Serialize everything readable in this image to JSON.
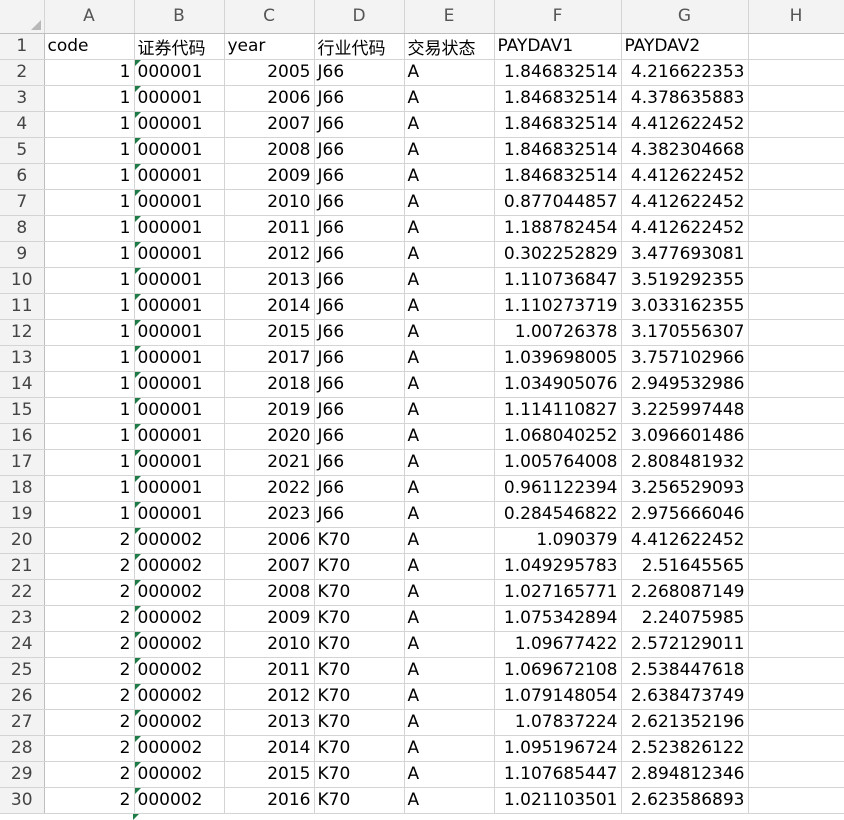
{
  "spreadsheet": {
    "columns": [
      "A",
      "B",
      "C",
      "D",
      "E",
      "F",
      "G",
      "H"
    ],
    "header_row": {
      "num": "1",
      "cells": [
        "code",
        "证券代码",
        "year",
        "行业代码",
        "交易状态",
        "PAYDAV1",
        "PAYDAV2",
        ""
      ]
    },
    "rows": [
      {
        "num": "2",
        "code": "1",
        "sec": "000001",
        "year": "2005",
        "ind": "J66",
        "status": "A",
        "p1": "1.846832514",
        "p2": "4.216622353"
      },
      {
        "num": "3",
        "code": "1",
        "sec": "000001",
        "year": "2006",
        "ind": "J66",
        "status": "A",
        "p1": "1.846832514",
        "p2": "4.378635883"
      },
      {
        "num": "4",
        "code": "1",
        "sec": "000001",
        "year": "2007",
        "ind": "J66",
        "status": "A",
        "p1": "1.846832514",
        "p2": "4.412622452"
      },
      {
        "num": "5",
        "code": "1",
        "sec": "000001",
        "year": "2008",
        "ind": "J66",
        "status": "A",
        "p1": "1.846832514",
        "p2": "4.382304668"
      },
      {
        "num": "6",
        "code": "1",
        "sec": "000001",
        "year": "2009",
        "ind": "J66",
        "status": "A",
        "p1": "1.846832514",
        "p2": "4.412622452"
      },
      {
        "num": "7",
        "code": "1",
        "sec": "000001",
        "year": "2010",
        "ind": "J66",
        "status": "A",
        "p1": "0.877044857",
        "p2": "4.412622452"
      },
      {
        "num": "8",
        "code": "1",
        "sec": "000001",
        "year": "2011",
        "ind": "J66",
        "status": "A",
        "p1": "1.188782454",
        "p2": "4.412622452"
      },
      {
        "num": "9",
        "code": "1",
        "sec": "000001",
        "year": "2012",
        "ind": "J66",
        "status": "A",
        "p1": "0.302252829",
        "p2": "3.477693081"
      },
      {
        "num": "10",
        "code": "1",
        "sec": "000001",
        "year": "2013",
        "ind": "J66",
        "status": "A",
        "p1": "1.110736847",
        "p2": "3.519292355"
      },
      {
        "num": "11",
        "code": "1",
        "sec": "000001",
        "year": "2014",
        "ind": "J66",
        "status": "A",
        "p1": "1.110273719",
        "p2": "3.033162355"
      },
      {
        "num": "12",
        "code": "1",
        "sec": "000001",
        "year": "2015",
        "ind": "J66",
        "status": "A",
        "p1": "1.00726378",
        "p2": "3.170556307"
      },
      {
        "num": "13",
        "code": "1",
        "sec": "000001",
        "year": "2017",
        "ind": "J66",
        "status": "A",
        "p1": "1.039698005",
        "p2": "3.757102966"
      },
      {
        "num": "14",
        "code": "1",
        "sec": "000001",
        "year": "2018",
        "ind": "J66",
        "status": "A",
        "p1": "1.034905076",
        "p2": "2.949532986"
      },
      {
        "num": "15",
        "code": "1",
        "sec": "000001",
        "year": "2019",
        "ind": "J66",
        "status": "A",
        "p1": "1.114110827",
        "p2": "3.225997448"
      },
      {
        "num": "16",
        "code": "1",
        "sec": "000001",
        "year": "2020",
        "ind": "J66",
        "status": "A",
        "p1": "1.068040252",
        "p2": "3.096601486"
      },
      {
        "num": "17",
        "code": "1",
        "sec": "000001",
        "year": "2021",
        "ind": "J66",
        "status": "A",
        "p1": "1.005764008",
        "p2": "2.808481932"
      },
      {
        "num": "18",
        "code": "1",
        "sec": "000001",
        "year": "2022",
        "ind": "J66",
        "status": "A",
        "p1": "0.961122394",
        "p2": "3.256529093"
      },
      {
        "num": "19",
        "code": "1",
        "sec": "000001",
        "year": "2023",
        "ind": "J66",
        "status": "A",
        "p1": "0.284546822",
        "p2": "2.975666046"
      },
      {
        "num": "20",
        "code": "2",
        "sec": "000002",
        "year": "2006",
        "ind": "K70",
        "status": "A",
        "p1": "1.090379",
        "p2": "4.412622452"
      },
      {
        "num": "21",
        "code": "2",
        "sec": "000002",
        "year": "2007",
        "ind": "K70",
        "status": "A",
        "p1": "1.049295783",
        "p2": "2.51645565"
      },
      {
        "num": "22",
        "code": "2",
        "sec": "000002",
        "year": "2008",
        "ind": "K70",
        "status": "A",
        "p1": "1.027165771",
        "p2": "2.268087149"
      },
      {
        "num": "23",
        "code": "2",
        "sec": "000002",
        "year": "2009",
        "ind": "K70",
        "status": "A",
        "p1": "1.075342894",
        "p2": "2.24075985"
      },
      {
        "num": "24",
        "code": "2",
        "sec": "000002",
        "year": "2010",
        "ind": "K70",
        "status": "A",
        "p1": "1.09677422",
        "p2": "2.572129011"
      },
      {
        "num": "25",
        "code": "2",
        "sec": "000002",
        "year": "2011",
        "ind": "K70",
        "status": "A",
        "p1": "1.069672108",
        "p2": "2.538447618"
      },
      {
        "num": "26",
        "code": "2",
        "sec": "000002",
        "year": "2012",
        "ind": "K70",
        "status": "A",
        "p1": "1.079148054",
        "p2": "2.638473749"
      },
      {
        "num": "27",
        "code": "2",
        "sec": "000002",
        "year": "2013",
        "ind": "K70",
        "status": "A",
        "p1": "1.07837224",
        "p2": "2.621352196"
      },
      {
        "num": "28",
        "code": "2",
        "sec": "000002",
        "year": "2014",
        "ind": "K70",
        "status": "A",
        "p1": "1.095196724",
        "p2": "2.523826122"
      },
      {
        "num": "29",
        "code": "2",
        "sec": "000002",
        "year": "2015",
        "ind": "K70",
        "status": "A",
        "p1": "1.107685447",
        "p2": "2.894812346"
      },
      {
        "num": "30",
        "code": "2",
        "sec": "000002",
        "year": "2016",
        "ind": "K70",
        "status": "A",
        "p1": "1.021103501",
        "p2": "2.623586893"
      }
    ],
    "colors": {
      "header_bg": "#f3f3f3",
      "gridline": "#d4d4d4",
      "error_indicator": "#1e7b45"
    }
  }
}
